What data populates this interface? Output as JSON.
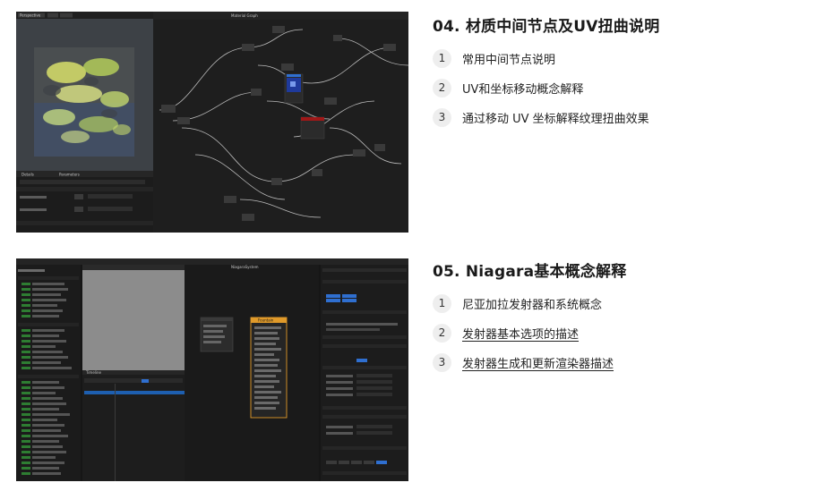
{
  "sections": [
    {
      "title": "04. 材质中间节点及UV扭曲说明",
      "items": [
        {
          "num": "1",
          "text": "常用中间节点说明"
        },
        {
          "num": "2",
          "text": "UV和坐标移动概念解释"
        },
        {
          "num": "3",
          "text": "通过移动 UV 坐标解释纹理扭曲效果"
        }
      ]
    },
    {
      "title": "05. Niagara基本概念解释",
      "items": [
        {
          "num": "1",
          "text": "尼亚加拉发射器和系统概念"
        },
        {
          "num": "2",
          "text": "发射器基本选项的描述"
        },
        {
          "num": "3",
          "text": "发射器生成和更新渲染器描述"
        }
      ]
    }
  ],
  "screenshots": {
    "material": {
      "viewport_tab": "Perspective",
      "graph_tab": "Material Graph",
      "details_tab": "Details",
      "params_tab": "Parameters",
      "accent": "#2f6fd0"
    },
    "niagara": {
      "graph_title": "NiagaraSystem",
      "emitter_node": "Fountain",
      "timeline_tab": "Timeline",
      "accent": "#e09a2a"
    }
  }
}
